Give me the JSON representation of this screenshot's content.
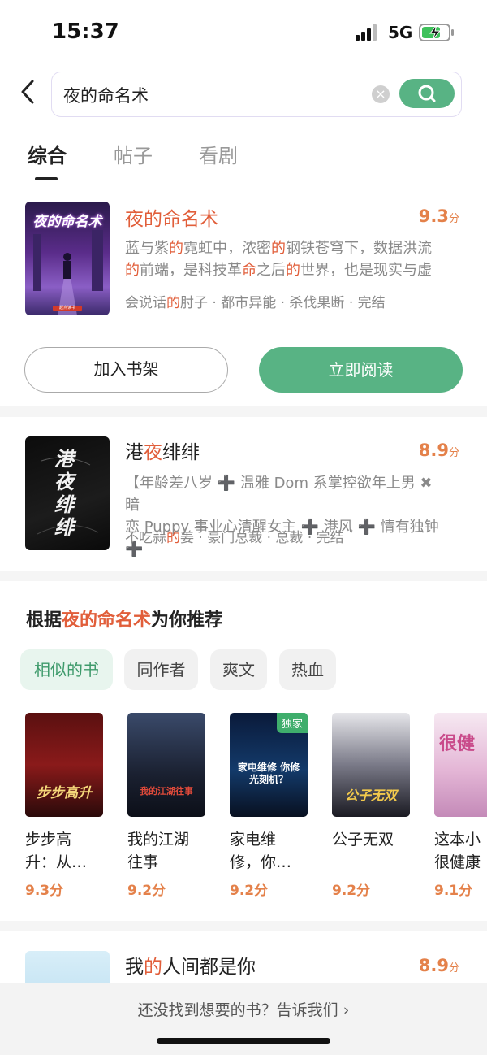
{
  "status_bar": {
    "time": "15:37",
    "network": "5G"
  },
  "search": {
    "query": "夜的命名术",
    "clear_icon": "clear-icon",
    "search_icon": "search-icon"
  },
  "tabs": [
    {
      "label": "综合",
      "active": true
    },
    {
      "label": "帖子",
      "active": false
    },
    {
      "label": "看剧",
      "active": false
    }
  ],
  "results": [
    {
      "title_parts": [
        "夜的命名术",
        ""
      ],
      "score": "9.3",
      "score_unit": "分",
      "desc_line1": [
        "蓝与紫",
        "的",
        "霓虹中，浓密",
        "的",
        "钢铁苍穹下，数据洪流"
      ],
      "desc_line2": [
        "的",
        "前端，是科技革",
        "命",
        "之后",
        "的",
        "世界，也是现实与虚"
      ],
      "meta": [
        "会说话",
        "的",
        "肘子 · 都市异能 · 杀伐果断 · 完结"
      ],
      "cover_title": "夜的命名术",
      "cover_publisher": "起点读书",
      "add_shelf_label": "加入书架",
      "read_label": "立即阅读"
    },
    {
      "title_parts": [
        "港",
        "夜",
        "绯绯"
      ],
      "score": "8.9",
      "score_unit": "分",
      "desc_line1": "【年龄差八岁 ➕ 温雅 Dom 系掌控欲年上男 ✖ 暗",
      "desc_line2": "恋 Puppy 事业心清醒女主 ➕ 港风 ➕ 情有独钟 ➕",
      "meta": [
        "不吃蒜",
        "的",
        "姜 · 豪门总裁 · 总裁 · 完结"
      ],
      "cover_title": "港夜绯绯"
    },
    {
      "title_parts": [
        "我",
        "的",
        "人间都是你"
      ],
      "score": "8.9",
      "score_unit": "分"
    }
  ],
  "recommend": {
    "title_prefix": "根据",
    "title_highlight": "夜的命名术",
    "title_suffix": "为你推荐",
    "chips": [
      {
        "label": "相似的书",
        "active": true
      },
      {
        "label": "同作者",
        "active": false
      },
      {
        "label": "爽文",
        "active": false
      },
      {
        "label": "热血",
        "active": false
      }
    ],
    "books": [
      {
        "name_line1": "步步高",
        "name_line2": "升：从…",
        "score": "9.3分",
        "cover_text": "步步高升"
      },
      {
        "name_line1": "我的江湖",
        "name_line2": "往事",
        "score": "9.2分",
        "cover_text": "我的江湖往事"
      },
      {
        "name_line1": "家电维",
        "name_line2": "修，你…",
        "score": "9.2分",
        "cover_text": "家电维修 你修光刻机？",
        "badge": "独家"
      },
      {
        "name_line1": "公子无双",
        "name_line2": "",
        "score": "9.2分",
        "cover_text": "公子无双"
      },
      {
        "name_line1": "这本小",
        "name_line2": "很健康",
        "score": "9.1分",
        "cover_text": "很健"
      }
    ]
  },
  "footer": {
    "feedback": "还没找到想要的书？告诉我们",
    "chevron_icon": "chevron-right-icon"
  },
  "colors": {
    "accent_green": "#58b384",
    "highlight": "#e15e3a",
    "score": "#e4814a"
  }
}
